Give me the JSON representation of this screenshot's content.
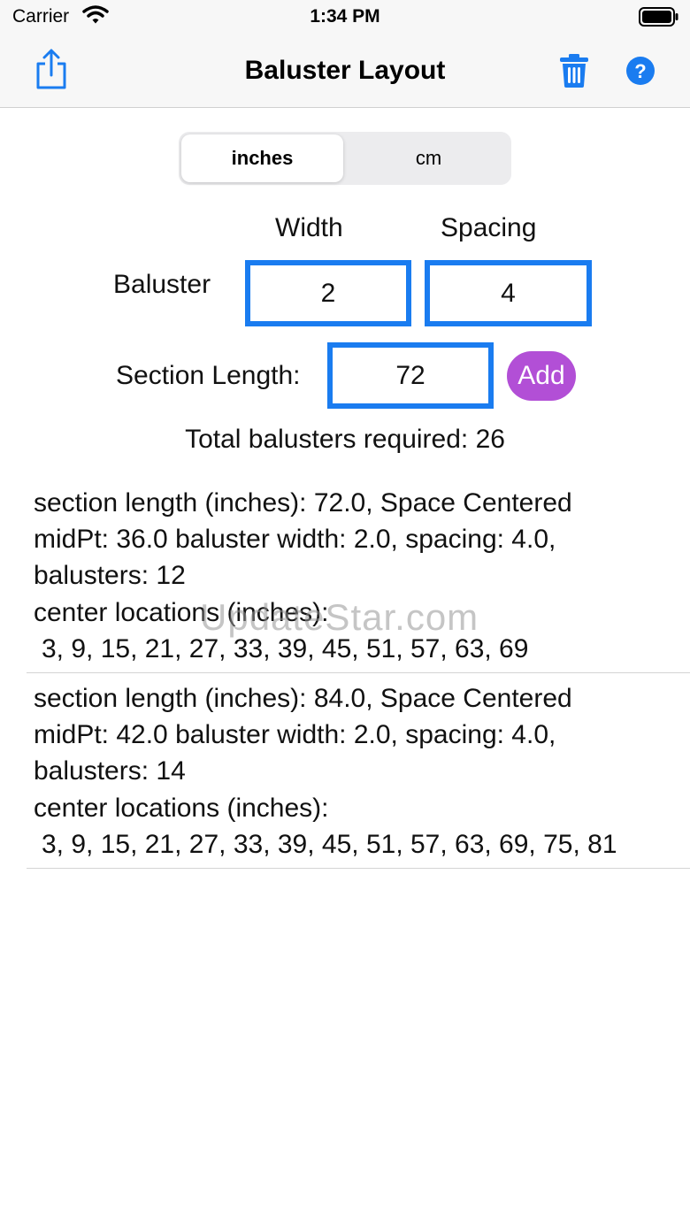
{
  "status_bar": {
    "carrier": "Carrier",
    "time": "1:34 PM"
  },
  "nav": {
    "title": "Baluster Layout",
    "share_icon": "share-icon",
    "trash_icon": "trash-icon",
    "help_icon": "help-icon"
  },
  "units": {
    "options": [
      "inches",
      "cm"
    ],
    "selected": "inches"
  },
  "form": {
    "width_label": "Width",
    "spacing_label": "Spacing",
    "baluster_label": "Baluster",
    "width_value": "2",
    "spacing_value": "4",
    "section_length_label": "Section Length:",
    "section_length_value": "72",
    "add_label": "Add"
  },
  "total_label": "Total balusters required: 26",
  "results": [
    {
      "line1": "section length (inches): 72.0, Space Centered",
      "line2": "midPt: 36.0 baluster width: 2.0, spacing: 4.0,",
      "line3": "balusters: 12",
      "line4": "center locations (inches):",
      "line5": "3, 9, 15, 21, 27, 33, 39, 45, 51, 57, 63, 69"
    },
    {
      "line1": "section length (inches): 84.0, Space Centered",
      "line2": "midPt: 42.0 baluster width: 2.0, spacing: 4.0,",
      "line3": "balusters: 14",
      "line4": "center locations (inches):",
      "line5": "3, 9, 15, 21, 27, 33, 39, 45, 51, 57, 63, 69, 75, 81"
    }
  ],
  "watermark": "UpdateStar.com",
  "colors": {
    "accent": "#1a7cf0",
    "add_button": "#b24fd6"
  }
}
